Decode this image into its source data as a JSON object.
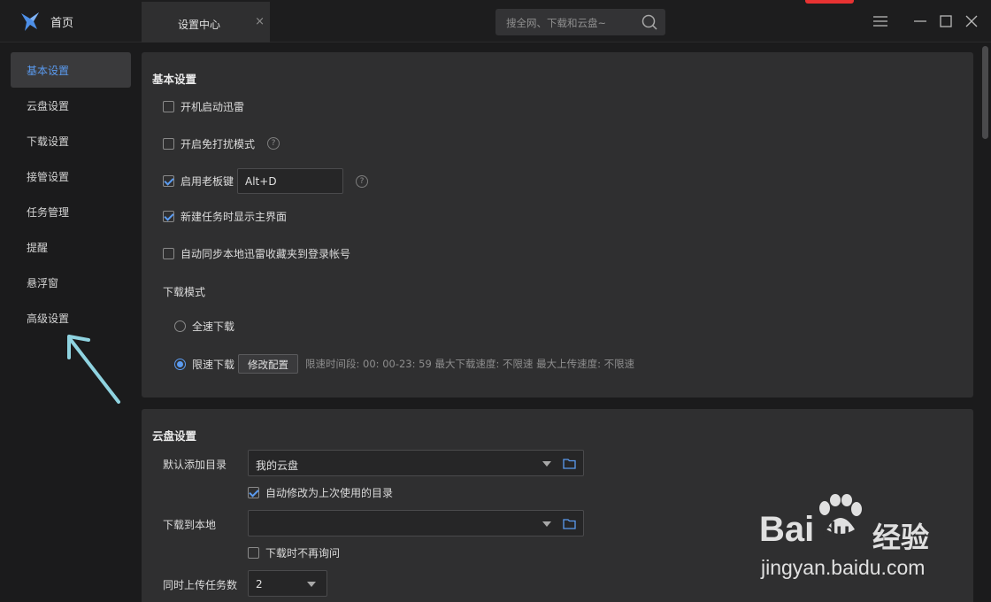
{
  "titlebar": {
    "home_label": "首页",
    "tab_label": "设置中心",
    "tab_close": "×",
    "search_placeholder": "搜全网、下载和云盘~",
    "accent_color": "#5b9bf0"
  },
  "sidebar": {
    "items": [
      {
        "label": "基本设置",
        "active": true
      },
      {
        "label": "云盘设置"
      },
      {
        "label": "下载设置"
      },
      {
        "label": "接管设置"
      },
      {
        "label": "任务管理"
      },
      {
        "label": "提醒"
      },
      {
        "label": "悬浮窗"
      },
      {
        "label": "高级设置"
      }
    ]
  },
  "basic": {
    "title": "基本设置",
    "autostart": {
      "label": "开机启动迅雷",
      "checked": false
    },
    "dnd": {
      "label": "开启免打扰模式",
      "checked": false
    },
    "bosskey": {
      "label": "启用老板键",
      "checked": true,
      "value": "Alt+D"
    },
    "show_main": {
      "label": "新建任务时显示主界面",
      "checked": true
    },
    "sync_fav": {
      "label": "自动同步本地迅雷收藏夹到登录帐号",
      "checked": false
    },
    "download_mode_label": "下载模式",
    "full_speed": {
      "label": "全速下载",
      "checked": false
    },
    "limited": {
      "label": "限速下载",
      "checked": true
    },
    "modify_button": "修改配置",
    "speed_info": "限速时间段: 00: 00-23: 59   最大下载速度: 不限速   最大上传速度: 不限速",
    "help_glyph": "?"
  },
  "cloud": {
    "title": "云盘设置",
    "default_dir_label": "默认添加目录",
    "default_dir_value": "我的云盘",
    "auto_modify": {
      "label": "自动修改为上次使用的目录",
      "checked": true
    },
    "download_local_label": "下载到本地",
    "download_local_value": "",
    "no_ask": {
      "label": "下载时不再询问",
      "checked": false
    },
    "upload_tasks_label": "同时上传任务数",
    "upload_tasks_value": "2"
  },
  "watermark": {
    "brand_left": "Bai",
    "brand_du": "du",
    "brand_cn": "经验",
    "url": "jingyan.baidu.com"
  }
}
